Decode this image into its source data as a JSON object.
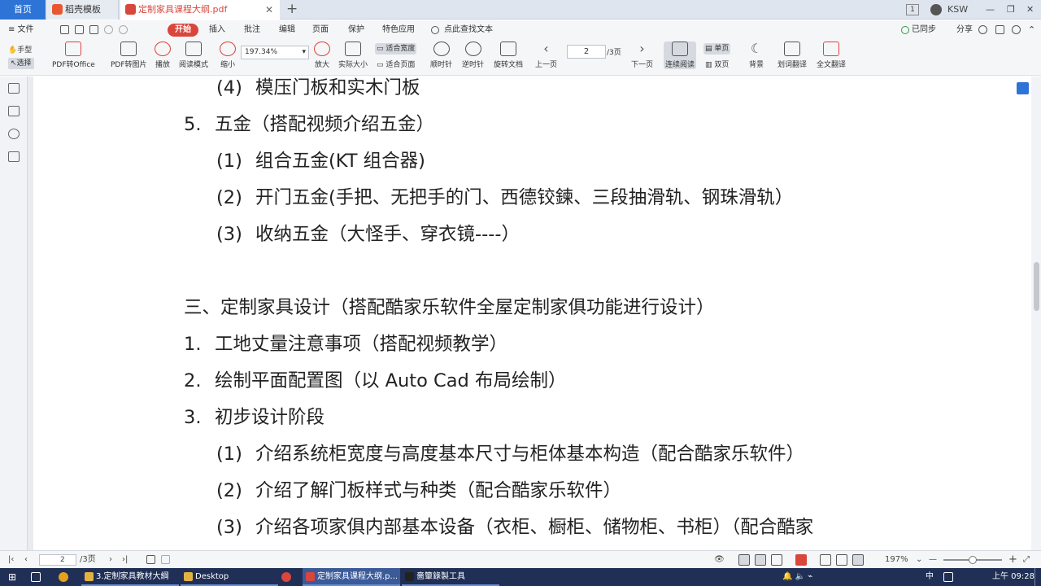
{
  "tabs": {
    "home": "首页",
    "template": "稻壳模板",
    "pdf": "定制家具课程大纲.pdf",
    "close": "✕",
    "add": "+"
  },
  "window": {
    "page_badge": "1",
    "user": "KSW",
    "minimize": "—",
    "restore": "❐",
    "close": "✕"
  },
  "menu": {
    "file": "≡ 文件",
    "items": [
      "开始",
      "插入",
      "批注",
      "编辑",
      "页面",
      "保护",
      "特色应用"
    ],
    "search": "点此查找文本",
    "sync": "已同步",
    "share": "分享"
  },
  "toolbar": {
    "hand": "手型",
    "select": "选择",
    "pdf_to_office": "PDF转Office",
    "pdf_to_image": "PDF转图片",
    "play": "播放",
    "read_mode": "阅读模式",
    "zoom_out": "缩小",
    "zoom_value": "197.34%",
    "zoom_in": "放大",
    "actual_size": "实际大小",
    "fit_width": "适合宽度",
    "fit_page": "适合页面",
    "rotate_cw": "顺时针",
    "rotate_ccw": "逆时针",
    "rotate_doc": "旋转文档",
    "prev_page": "上一页",
    "page_current": "2",
    "page_total": "/3页",
    "next_page": "下一页",
    "continuous": "连续阅读",
    "single": "单页",
    "double": "双页",
    "background": "背景",
    "word_translate": "划词翻译",
    "full_translate": "全文翻译"
  },
  "document": {
    "lines": [
      {
        "num": "(4)",
        "text": "模压门板和实木门板"
      },
      {
        "num": "5.",
        "text": "五金（搭配视频介绍五金）"
      },
      {
        "num": "(1)",
        "text": "组合五金(KT 组合器)"
      },
      {
        "num": "(2)",
        "text": "开门五金(手把、无把手的门、西德铰鍊、三段抽滑轨、钢珠滑轨）"
      },
      {
        "num": "(3)",
        "text": "收纳五金（大怪手、穿衣镜----）"
      },
      {
        "num": "",
        "text": "三、定制家具设计（搭配酷家乐软件全屋定制家俱功能进行设计）"
      },
      {
        "num": "1.",
        "text": "工地丈量注意事项（搭配视频教学）"
      },
      {
        "num": "2.",
        "text": "绘制平面配置图（以 Auto Cad  布局绘制）"
      },
      {
        "num": "3.",
        "text": "初步设计阶段"
      },
      {
        "num": "(1)",
        "text": "介绍系统柜宽度与高度基本尺寸与柜体基本构造（配合酷家乐软件）"
      },
      {
        "num": "(2)",
        "text": "介绍了解门板样式与种类（配合酷家乐软件）"
      },
      {
        "num": "(3)",
        "text": "介绍各项家俱内部基本设备（衣柜、橱柜、储物柜、书柜）（配合酷家"
      }
    ]
  },
  "status": {
    "page_current": "2",
    "page_total": "/3页",
    "zoom": "197%",
    "minus": "—",
    "plus": "+"
  },
  "taskbar": {
    "tasks": [
      "3.定制家具教材大綱",
      "Desktop",
      "定制家具课程大纲.p...",
      "嗇簞錄製工具"
    ],
    "ime": "中",
    "clock": "上午 09:28"
  },
  "colors": {
    "accent": "#2e74d6",
    "start_red": "#d9463c",
    "taskbar": "#1f2f55"
  }
}
